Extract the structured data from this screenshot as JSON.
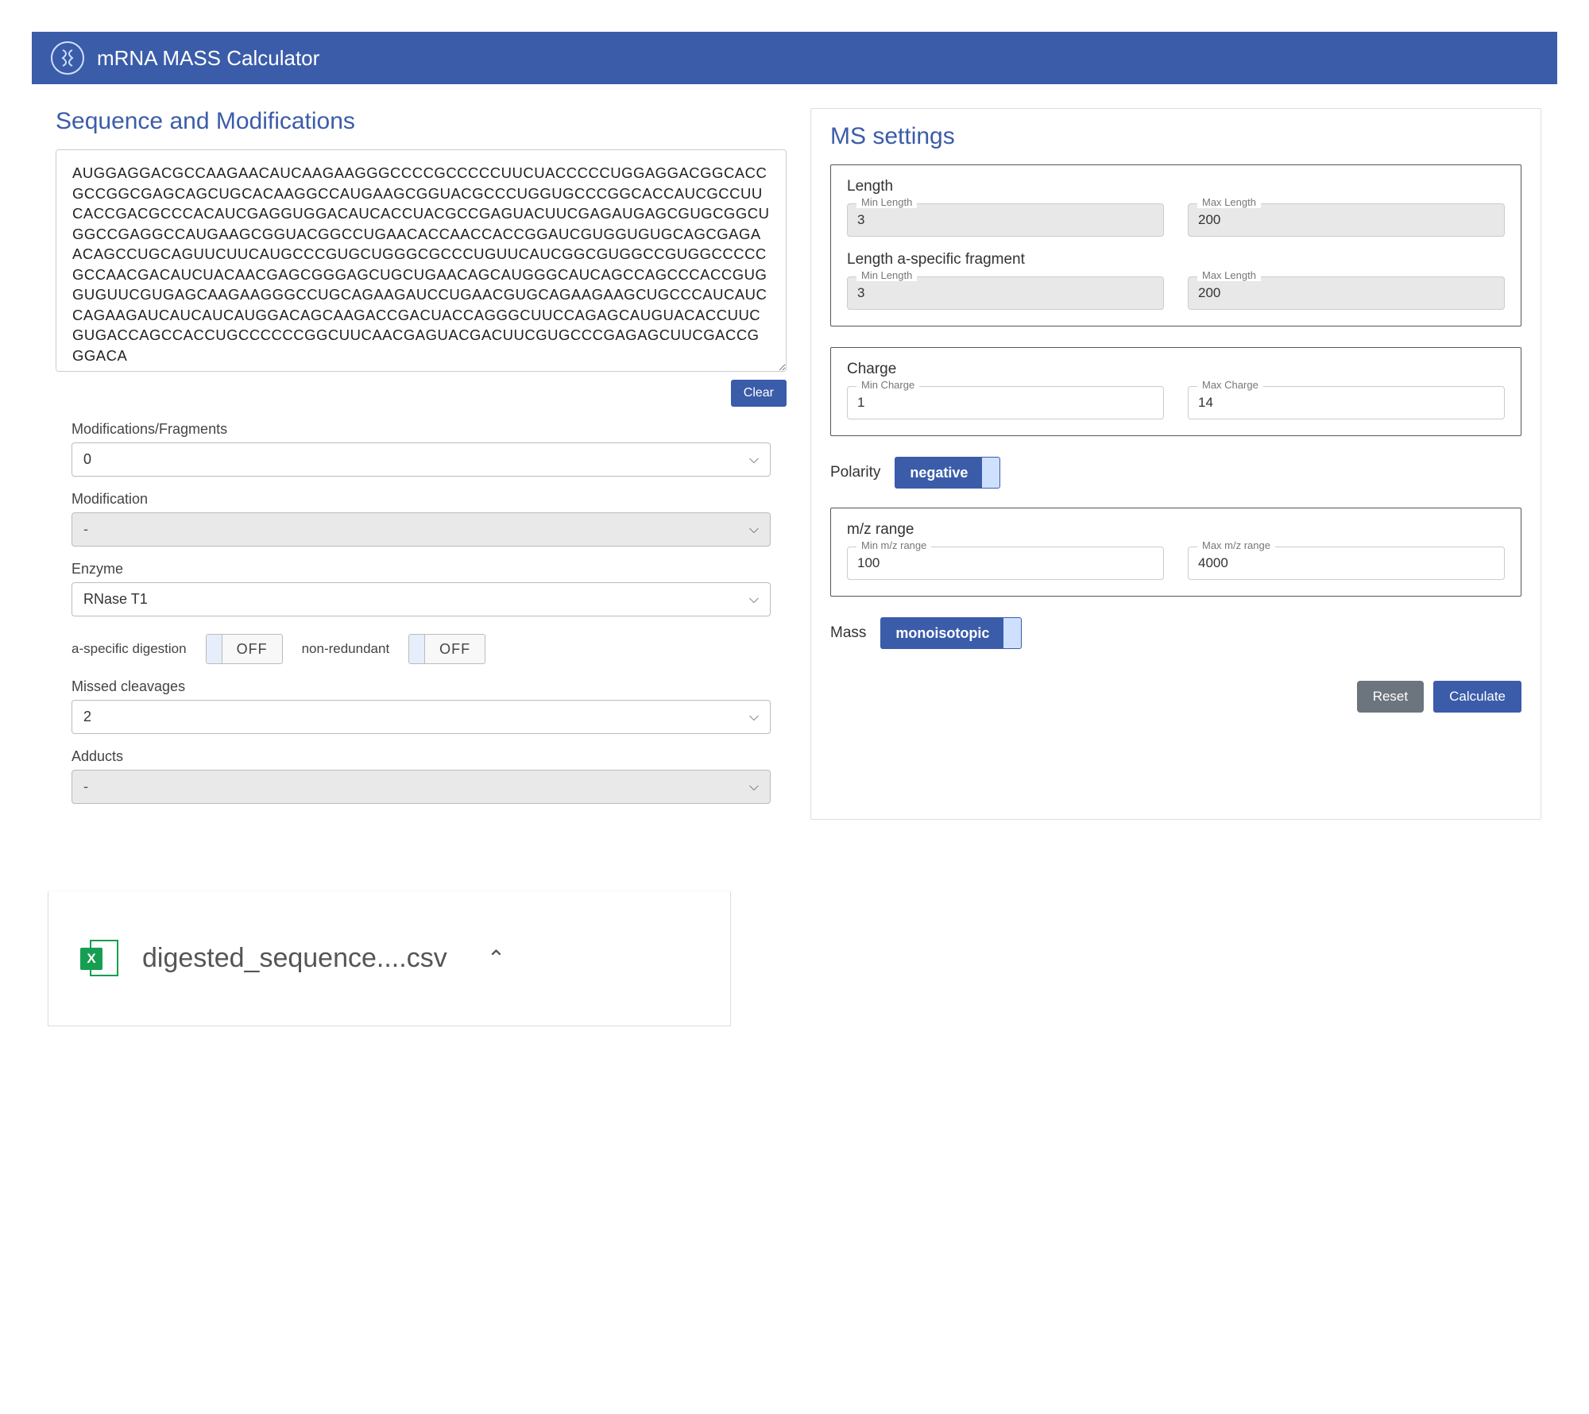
{
  "header": {
    "title": "mRNA MASS Calculator"
  },
  "left": {
    "title": "Sequence and Modifications",
    "sequence": "AUGGAGGACGCCAAGAACAUCAAGAAGGGCCCCGCCCCCUUCUACCCCCUGGAGGACGGCACCGCCGGCGAGCAGCUGCACAAGGCCAUGAAGCGGUACGCCCUGGUGCCCGGCACCAUCGCCUUCACCGACGCCCACAUCGAGGUGGACAUCACCUACGCCGAGUACUUCGAGAUGAGCGUGCGGCUGGCCGAGGCCAUGAAGCGGUACGGCCUGAACACCAACCACCGGAUCGUGGUGUGCAGCGAGAACAGCCUGCAGUUCUUCAUGCCCGUGCUGGGCGCCCUGUUCAUCGGCGUGGCCGUGGCCCCCGCCAACGACAUCUACAACGAGCGGGAGCUGCUGAACAGCAUGGGCAUCAGCCAGCCCACCGUGGUGUUCGUGAGCAAGAAGGGCCUGCAGAAGAUCCUGAACGUGCAGAAGAAGCUGCCCAUCAUCCAGAAGAUCAUCAUCAUGGACAGCAAGACCGACUACCAGGGCUUCCAGAGCAUGUACACCUUCGUGACCAGCCACCUGCCCCCCGGCUUCAACGAGUACGACUUCGUGCCCGAGAGCUUCGACCGGGACA",
    "clear_label": "Clear",
    "mods_label": "Modifications/Fragments",
    "mods_value": "0",
    "modification_label": "Modification",
    "modification_value": "-",
    "enzyme_label": "Enzyme",
    "enzyme_value": "RNase T1",
    "aspecific_label": "a-specific digestion",
    "aspecific_value": "OFF",
    "nonredundant_label": "non-redundant",
    "nonredundant_value": "OFF",
    "missed_label": "Missed cleavages",
    "missed_value": "2",
    "adducts_label": "Adducts",
    "adducts_value": "-"
  },
  "right": {
    "title": "MS settings",
    "length_title": "Length",
    "length_min_label": "Min Length",
    "length_min": "3",
    "length_max_label": "Max Length",
    "length_max": "200",
    "aspec_title": "Length a-specific fragment",
    "aspec_min_label": "Min Length",
    "aspec_min": "3",
    "aspec_max_label": "Max Length",
    "aspec_max": "200",
    "charge_title": "Charge",
    "charge_min_label": "Min Charge",
    "charge_min": "1",
    "charge_max_label": "Max Charge",
    "charge_max": "14",
    "polarity_label": "Polarity",
    "polarity_value": "negative",
    "mz_title": "m/z range",
    "mz_min_label": "Min m/z range",
    "mz_min": "100",
    "mz_max_label": "Max m/z range",
    "mz_max": "4000",
    "mass_label": "Mass",
    "mass_value": "monoisotopic",
    "reset_label": "Reset",
    "calc_label": "Calculate"
  },
  "download": {
    "filename": "digested_sequence....csv",
    "badge": "X"
  }
}
